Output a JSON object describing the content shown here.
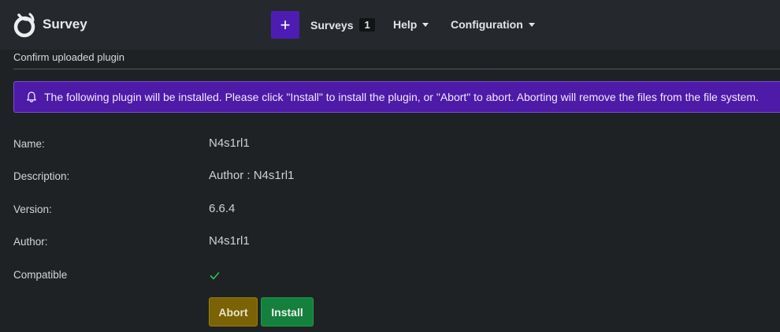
{
  "navbar": {
    "brand_name": "Survey",
    "add_label": "+",
    "surveys_label": "Surveys",
    "surveys_count": "1",
    "help_label": "Help",
    "configuration_label": "Configuration"
  },
  "section": {
    "title": "Confirm uploaded plugin"
  },
  "alert": {
    "icon": "bell-icon",
    "text": "The following plugin will be installed. Please click \"Install\" to install the plugin, or \"Abort\" to abort. Aborting will remove the files from the file system."
  },
  "details": {
    "name_label": "Name:",
    "name_value": "N4s1rl1",
    "description_label": "Description:",
    "description_value": "Author : N4s1rl1",
    "version_label": "Version:",
    "version_value": "6.6.4",
    "author_label": "Author:",
    "author_value": "N4s1rl1",
    "compatible_label": "Compatible",
    "compatible_icon": "check-icon"
  },
  "actions": {
    "abort_label": "Abort",
    "install_label": "Install"
  },
  "colors": {
    "background": "#1f2225",
    "navbar": "#25292d",
    "primary": "#4d1db3",
    "alert": "#4e1aa8",
    "abort": "#7a6205",
    "install": "#15803d",
    "check": "#22c55e"
  }
}
